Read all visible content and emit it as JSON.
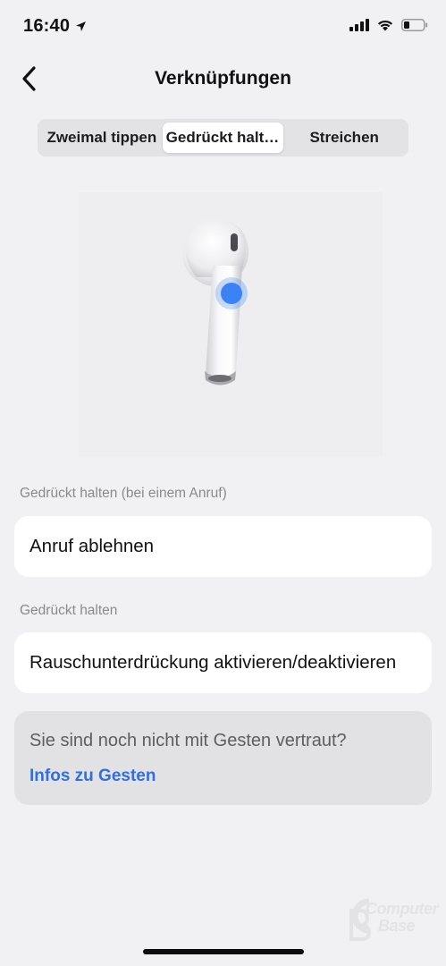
{
  "status_bar": {
    "time": "16:40"
  },
  "header": {
    "title": "Verknüpfungen"
  },
  "tabs": [
    {
      "label": "Zweimal tippen",
      "active": false
    },
    {
      "label": "Gedrückt halten",
      "active": true
    },
    {
      "label": "Streichen",
      "active": false
    }
  ],
  "sections": [
    {
      "label": "Gedrückt halten (bei einem Anruf)",
      "value": "Anruf ablehnen"
    },
    {
      "label": "Gedrückt halten",
      "value": "Rauschunterdrückung aktivieren/deaktivieren"
    }
  ],
  "info": {
    "text": "Sie sind noch nicht mit Gesten vertraut?",
    "link": "Infos zu Gesten"
  },
  "watermark": {
    "line1": "Computer",
    "line2": "Base"
  },
  "colors": {
    "background": "#f1f1f3",
    "accent_blue": "#2f6fe0",
    "touch_dot": "#3b82f6"
  }
}
